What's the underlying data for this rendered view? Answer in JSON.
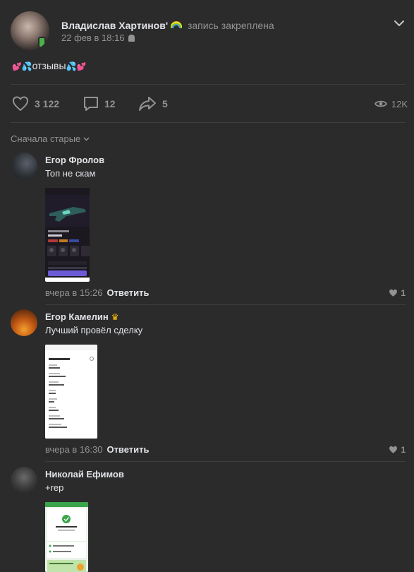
{
  "post": {
    "author": "Владислав Хартинов'",
    "pinned_label": "запись закреплена",
    "date": "22 фев в 18:16",
    "text": "отзывы",
    "likes": "3 122",
    "comments": "12",
    "shares": "5",
    "views": "12K"
  },
  "sort_label": "Сначала старые",
  "comments": [
    {
      "author": "Егор Фролов",
      "text": "Топ не скам",
      "time": "вчера в 15:26",
      "reply_label": "Ответить",
      "likes": "1"
    },
    {
      "author": "Егор Камелин",
      "text": "Лучший провёл сделку",
      "time": "вчера в 16:30",
      "reply_label": "Ответить",
      "likes": "1"
    },
    {
      "author": "Николай Ефимов",
      "text": "+rep"
    }
  ],
  "icons": [
    "android-icon",
    "chevron-down-icon",
    "heart-icon",
    "comment-icon",
    "share-icon",
    "eye-icon",
    "crown-icon"
  ],
  "colors": {
    "background": "#2b2b2c",
    "text": "#e1e3e6",
    "muted": "#939393",
    "divider": "#3d3d3e"
  }
}
